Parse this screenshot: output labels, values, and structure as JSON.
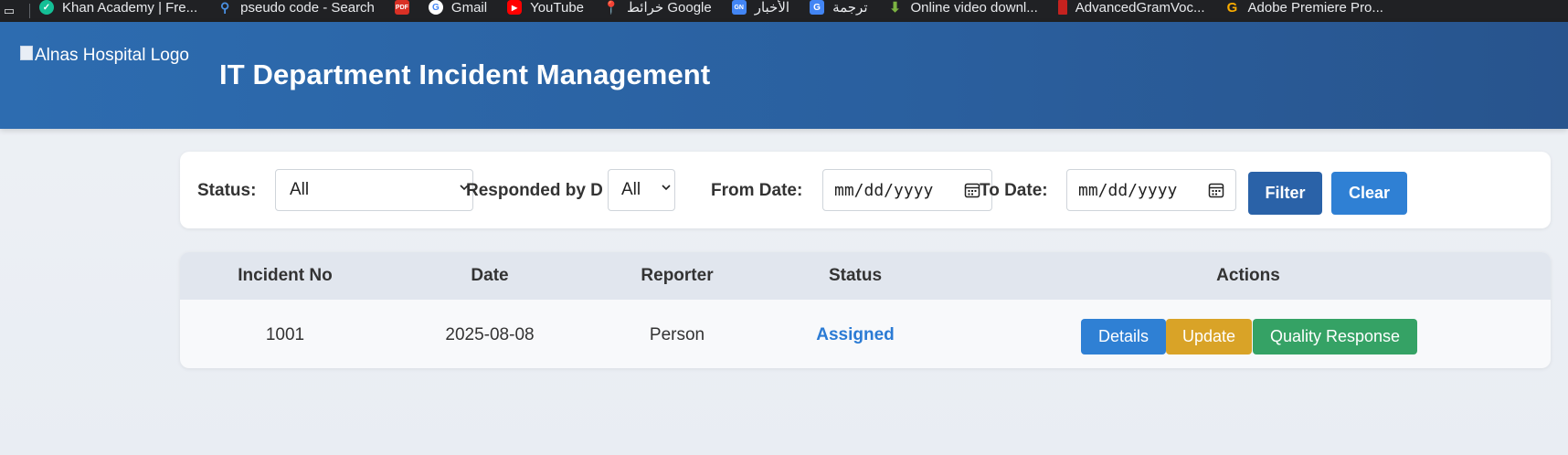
{
  "bookmarks": [
    {
      "label": "Khan Academy | Fre...",
      "icon": "khan-academy-icon",
      "color": "#14bf96"
    },
    {
      "label": "pseudo code - Search",
      "icon": "search-icon",
      "color": "#1a73e8"
    },
    {
      "label": "",
      "icon": "pdf-icon",
      "color": "#d93025",
      "badge": "PDF"
    },
    {
      "label": "Gmail",
      "icon": "google-icon",
      "color": "#ffffff"
    },
    {
      "label": "YouTube",
      "icon": "youtube-icon",
      "color": "#ff0000"
    },
    {
      "label": "خرائط Google",
      "icon": "maps-icon",
      "color": "#34a853"
    },
    {
      "label": "الأخبار",
      "icon": "news-icon",
      "color": "#4285f4",
      "badge": "GN"
    },
    {
      "label": "ترجمة",
      "icon": "translate-icon",
      "color": "#4285f4",
      "badge": "G"
    },
    {
      "label": "Online video downl...",
      "icon": "download-icon",
      "color": "#7cb342"
    },
    {
      "label": "AdvancedGramVoc...",
      "icon": "bookmark-red-icon",
      "color": "#c5221f"
    },
    {
      "label": "Adobe Premiere Pro...",
      "icon": "g-letter-icon",
      "color": "#f9ab00",
      "badge": "G"
    }
  ],
  "header": {
    "logo_alt": "Alnas Hospital Logo",
    "title": "IT Department Incident Management"
  },
  "filters": {
    "status_label": "Status:",
    "status_value": "All",
    "responded_label": "Responded by D",
    "responded_value": "All",
    "from_label": "From Date:",
    "from_placeholder": "mm/dd/yyyy",
    "to_label": "To Date:",
    "to_placeholder": "mm/dd/yyyy",
    "filter_button": "Filter",
    "clear_button": "Clear"
  },
  "table": {
    "columns": [
      "Incident No",
      "Date",
      "Reporter",
      "Status",
      "Actions"
    ],
    "rows": [
      {
        "incident_no": "1001",
        "date": "2025-08-08",
        "reporter": "Person",
        "status": "Assigned",
        "actions": [
          "Details",
          "Update",
          "Quality Response"
        ]
      }
    ]
  },
  "colors": {
    "header": "#2d6cb0",
    "filter_button": "#2a62a8",
    "clear_button": "#2f80d4",
    "details_button": "#2f80d4",
    "update_button": "#d9a327",
    "quality_button": "#35a265",
    "status_assigned": "#2b7bd4"
  }
}
